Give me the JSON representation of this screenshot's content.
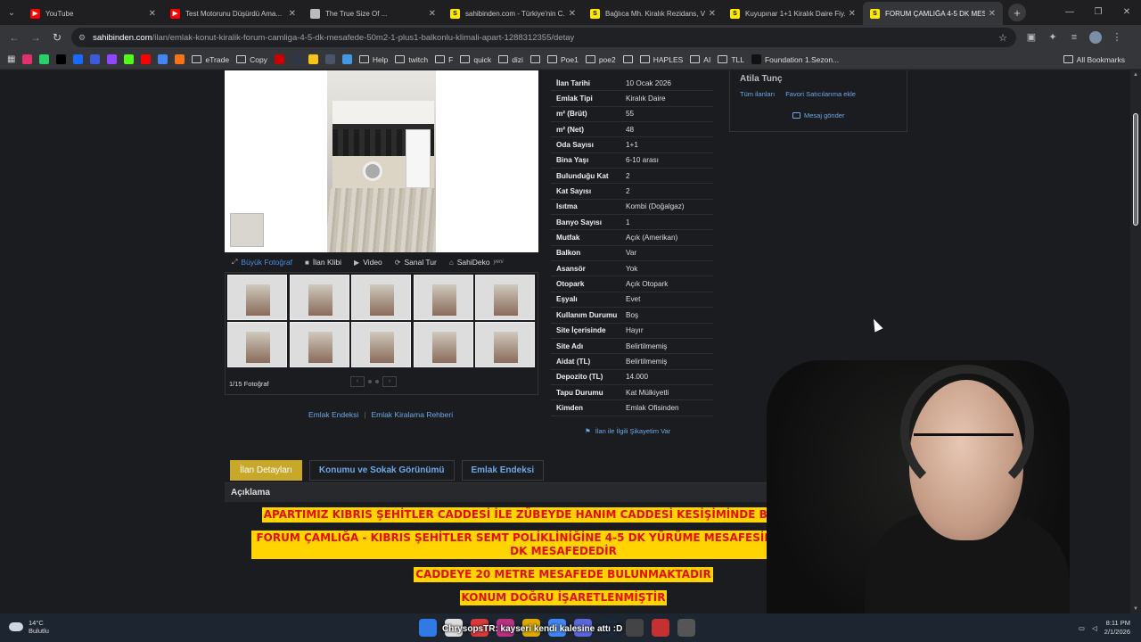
{
  "browser": {
    "tabs": [
      {
        "title": "YouTube",
        "color": "#ff0000",
        "glyph": "▶"
      },
      {
        "title": "Test Motorunu Düşürdü Ama...",
        "color": "#ff0000",
        "glyph": "▶"
      },
      {
        "title": "The True Size Of ...",
        "color": "#bbbbbb",
        "glyph": ""
      },
      {
        "title": "sahibinden.com - Türkiye'nin C...",
        "color": "#ffe800",
        "glyph": "S"
      },
      {
        "title": "Bağlıca Mh. Kiralık Rezidans, Ve...",
        "color": "#ffe800",
        "glyph": "S"
      },
      {
        "title": "Kuyupınar 1+1 Kiralık Daire Fiy...",
        "color": "#ffe800",
        "glyph": "S"
      },
      {
        "title": "FORUM ÇAMLIĞA 4-5 DK MESA...",
        "color": "#ffe800",
        "glyph": "S",
        "active": true
      }
    ],
    "url_domain": "sahibinden.com",
    "url_path": "/ilan/emlak-konut-kiralik-forum-camliga-4-5-dk-mesafede-50m2-1-plus1-balkonlu-klimali-apart-1288312355/detay",
    "bookmarks": [
      {
        "label": "",
        "color": "#e1306c"
      },
      {
        "label": "",
        "color": "#25d366"
      },
      {
        "label": "",
        "color": "#000000"
      },
      {
        "label": "",
        "color": "#1769ff"
      },
      {
        "label": "",
        "color": "#3b5bdb"
      },
      {
        "label": "",
        "color": "#9146ff"
      },
      {
        "label": "",
        "color": "#53fc18"
      },
      {
        "label": "",
        "color": "#ff0000"
      },
      {
        "label": "",
        "color": "#4285f4"
      },
      {
        "label": "",
        "color": "#f97316"
      },
      {
        "label": "eTrade",
        "folder": true
      },
      {
        "label": "Copy",
        "folder": true
      },
      {
        "label": "",
        "color": "#cc0000"
      },
      {
        "label": "",
        "color": "#2d3748"
      },
      {
        "label": "",
        "color": "#f5c518"
      },
      {
        "label": "",
        "color": "#4a5568"
      },
      {
        "label": "",
        "color": "#4299e1"
      },
      {
        "label": "Help",
        "folder": true
      },
      {
        "label": "twitch",
        "folder": true
      },
      {
        "label": "F",
        "folder": true
      },
      {
        "label": "quick",
        "folder": true
      },
      {
        "label": "dizi",
        "folder": true
      },
      {
        "label": "",
        "folder": true
      },
      {
        "label": "Poe1",
        "folder": true
      },
      {
        "label": "poe2",
        "folder": true
      },
      {
        "label": "",
        "folder": true
      },
      {
        "label": "HAPLES",
        "folder": true
      },
      {
        "label": "AI",
        "folder": true
      },
      {
        "label": "TLL",
        "folder": true
      },
      {
        "label": "Foundation 1.Sezon...",
        "color": "#111111"
      }
    ],
    "all_bookmarks": "All Bookmarks"
  },
  "gallery": {
    "media_buttons": [
      {
        "label": "Büyük Fotoğraf",
        "icon": "zoom-icon",
        "active": true
      },
      {
        "label": "İlan Klibi",
        "icon": "video-camera-icon"
      },
      {
        "label": "Video",
        "icon": "play-icon"
      },
      {
        "label": "Sanal Tur",
        "icon": "360-icon"
      },
      {
        "label": "SahiDeko",
        "icon": "home-icon",
        "badge": "yeni"
      }
    ],
    "photo_count": "1/15 Fotoğraf"
  },
  "links_under": {
    "a": "Emlak Endeksi",
    "b": "Emlak Kiralama Rehberi"
  },
  "details": [
    {
      "k": "İlan Tarihi",
      "v": "10 Ocak 2026"
    },
    {
      "k": "Emlak Tipi",
      "v": "Kiralık Daire"
    },
    {
      "k": "m² (Brüt)",
      "v": "55"
    },
    {
      "k": "m² (Net)",
      "v": "48"
    },
    {
      "k": "Oda Sayısı",
      "v": "1+1"
    },
    {
      "k": "Bina Yaşı",
      "v": "6-10 arası"
    },
    {
      "k": "Bulunduğu Kat",
      "v": "2"
    },
    {
      "k": "Kat Sayısı",
      "v": "2"
    },
    {
      "k": "Isıtma",
      "v": "Kombi (Doğalgaz)"
    },
    {
      "k": "Banyo Sayısı",
      "v": "1"
    },
    {
      "k": "Mutfak",
      "v": "Açık (Amerikan)"
    },
    {
      "k": "Balkon",
      "v": "Var"
    },
    {
      "k": "Asansör",
      "v": "Yok"
    },
    {
      "k": "Otopark",
      "v": "Açık Otopark"
    },
    {
      "k": "Eşyalı",
      "v": "Evet"
    },
    {
      "k": "Kullanım Durumu",
      "v": "Boş"
    },
    {
      "k": "Site İçerisinde",
      "v": "Hayır"
    },
    {
      "k": "Site Adı",
      "v": "Belirtilmemiş"
    },
    {
      "k": "Aidat (TL)",
      "v": "Belirtilmemiş"
    },
    {
      "k": "Depozito (TL)",
      "v": "14.000"
    },
    {
      "k": "Tapu Durumu",
      "v": "Kat Mülkiyetli"
    },
    {
      "k": "Kimden",
      "v": "Emlak Ofisinden"
    }
  ],
  "complaint": "İlan ile İlgili Şikayetim Var",
  "seller": {
    "name": "Atila Tunç",
    "all_listings": "Tüm ilanları",
    "favorite": "Favori Satıcılarıma ekle",
    "message": "Mesaj gönder"
  },
  "page_tabs": [
    {
      "label": "İlan Detayları",
      "active": true
    },
    {
      "label": "Konumu ve Sokak Görünümü"
    },
    {
      "label": "Emlak Endeksi"
    }
  ],
  "description": {
    "heading": "Açıklama",
    "lines": [
      "APARTIMIZ KIBRIS ŞEHİTLER CADDESİ İLE ZÜBEYDE HANIM CADDESİ KESİŞİMİNDE BULUNMAKTADIR",
      "FORUM ÇAMLIĞA - KIBRIS ŞEHİTLER SEMT POLİKLİNİĞİNE  4-5 DK YÜRÜME MESAFESİNDE METEROLO... DK MESAFEDEDİR",
      "CADDEYE 20 METRE MESAFEDE BULUNMAKTADIR",
      "KONUM DOĞRU İŞARETLENMİŞTİR"
    ]
  },
  "taskbar": {
    "temp": "14°C",
    "weather": "Bulutlu",
    "time": "8:11 PM",
    "date": "2/1/2026",
    "chat_overlay": "ChrysopsTR: kayseri kendi kalesine attı :D"
  }
}
